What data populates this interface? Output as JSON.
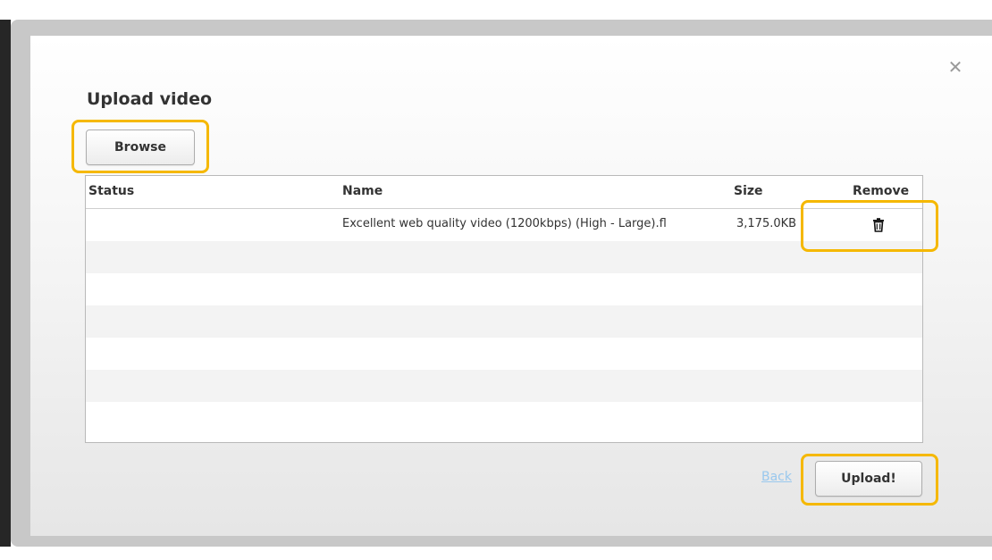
{
  "dialog": {
    "title": "Upload video",
    "close_icon": "close-icon",
    "browse_label": "Browse",
    "back_label": "Back",
    "upload_label": "Upload!",
    "highlight_color": "#f5b800"
  },
  "table": {
    "headers": {
      "status": "Status",
      "name": "Name",
      "size": "Size",
      "remove": "Remove"
    },
    "rows": [
      {
        "status": "",
        "name": "Excellent web quality video (1200kbps) (High - Large).fl",
        "size": "3,175.0KB",
        "remove_icon": "trash-icon"
      }
    ]
  }
}
